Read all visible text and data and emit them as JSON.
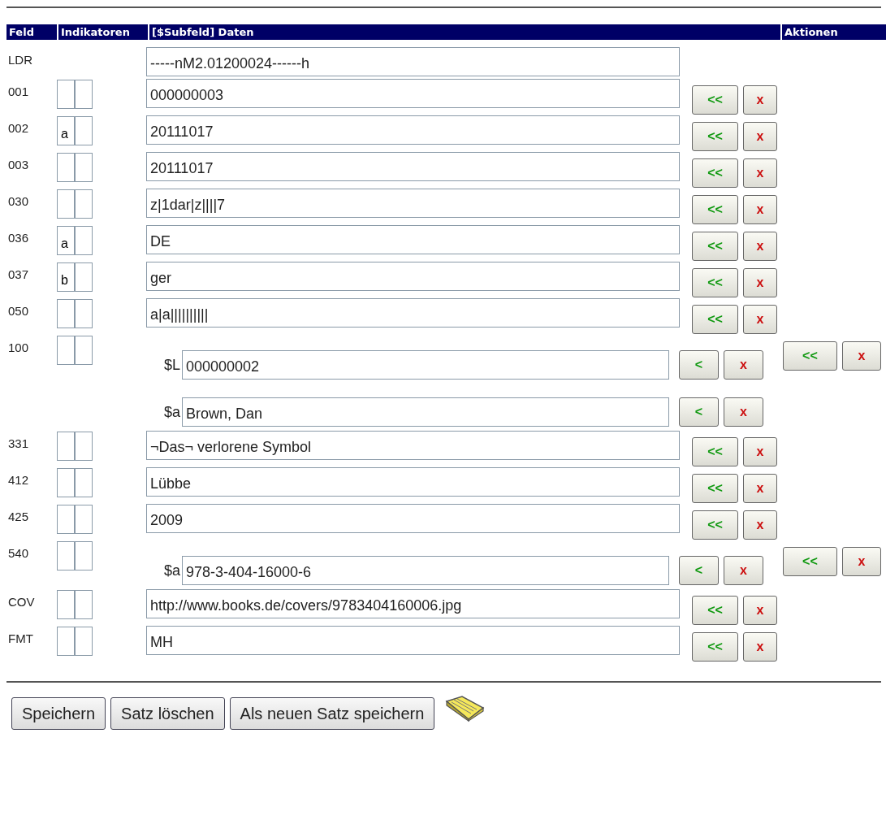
{
  "header": {
    "columns": [
      "Feld",
      "Indikatoren",
      "[$Subfeld] Daten",
      "Aktionen"
    ]
  },
  "fields": [
    {
      "kind": "leader",
      "tag": "LDR",
      "value": "-----nM2.01200024------h"
    },
    {
      "kind": "field",
      "tag": "001",
      "value": "000000003",
      "actions": [
        "<<",
        "x"
      ]
    },
    {
      "kind": "field",
      "tag": "002",
      "indicators": [
        "a"
      ],
      "value": "20111017",
      "actions": [
        "<<",
        "x"
      ]
    },
    {
      "kind": "field",
      "tag": "003",
      "value": "20111017",
      "actions": [
        "<<",
        "x"
      ]
    },
    {
      "kind": "field",
      "tag": "030",
      "value": "z|1dar|z||||7",
      "actions": [
        "<<",
        "x"
      ]
    },
    {
      "kind": "field",
      "tag": "036",
      "indicators": [
        "a"
      ],
      "value": "DE",
      "actions": [
        "<<",
        "x"
      ]
    },
    {
      "kind": "field",
      "tag": "037",
      "indicators": [
        "b"
      ],
      "value": "ger",
      "actions": [
        "<<",
        "x"
      ]
    },
    {
      "kind": "field",
      "tag": "050",
      "value": "a|a||||||||||",
      "actions": [
        "<<",
        "x"
      ]
    },
    {
      "kind": "subfields",
      "tag": "100",
      "subfields": [
        {
          "code": "$L",
          "value": "000000002",
          "buttons": [
            "<",
            "x"
          ]
        },
        {
          "code": "$a",
          "value": "Brown, Dan",
          "buttons": [
            "<",
            "x"
          ]
        }
      ],
      "actions": [
        "<<",
        "x"
      ]
    },
    {
      "kind": "field",
      "tag": "331",
      "value": "¬Das¬ verlorene Symbol",
      "actions": [
        "<<",
        "x"
      ]
    },
    {
      "kind": "field",
      "tag": "412",
      "value": "Lübbe",
      "actions": [
        "<<",
        "x"
      ]
    },
    {
      "kind": "field",
      "tag": "425",
      "value": "2009",
      "actions": [
        "<<",
        "x"
      ]
    },
    {
      "kind": "subfields",
      "tag": "540",
      "subfields": [
        {
          "code": "$a",
          "value": "978-3-404-16000-6",
          "buttons": [
            "<",
            "x"
          ]
        }
      ],
      "actions": [
        "<<",
        "x"
      ]
    },
    {
      "kind": "field",
      "tag": "COV",
      "value": "http://www.books.de/covers/9783404160006.jpg",
      "actions": [
        "<<",
        "x"
      ]
    },
    {
      "kind": "field",
      "tag": "FMT",
      "value": "MH",
      "actions": [
        "<<",
        "x"
      ]
    }
  ],
  "buttons": [
    "Speichern",
    "Satz löschen",
    "Als neuen Satz speichern"
  ]
}
